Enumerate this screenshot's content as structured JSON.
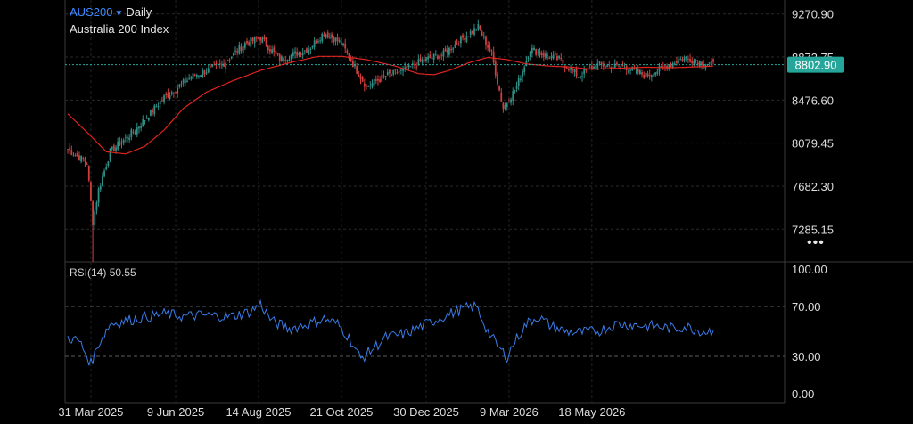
{
  "header": {
    "symbol": "AUS200",
    "interval": "Daily",
    "subtitle": "Australia 200 Index"
  },
  "price_axis": {
    "labels": [
      "9270.90",
      "8873.75",
      "8476.60",
      "8079.45",
      "7682.30",
      "7285.15"
    ],
    "last_price": "8802.90"
  },
  "rsi": {
    "label": "RSI(14)",
    "value": "50.55",
    "axis_labels": [
      "100.00",
      "70.00",
      "30.00",
      "0.00"
    ]
  },
  "time_axis": {
    "labels": [
      "31 Mar 2025",
      "9 Jun 2025",
      "14 Aug 2025",
      "21 Oct 2025",
      "30 Dec 2025",
      "9 Mar 2026",
      "18 May 2026"
    ]
  },
  "more_glyph": "•••",
  "colors": {
    "background": "#000000",
    "up": "#2f8f86",
    "down": "#d03e3e",
    "ma": "#e0241f",
    "rsi": "#3a7ce8",
    "last_price": "#26a69a",
    "symbol": "#3d8bff"
  },
  "chart_data": [
    {
      "type": "candlestick",
      "ylim": [
        7000,
        9400
      ],
      "y_ticks": [
        9270.9,
        8873.75,
        8476.6,
        8079.45,
        7682.3,
        7285.15
      ],
      "last_price": 8802.9,
      "x_ticks": [
        "31 Mar 2025",
        "9 Jun 2025",
        "14 Aug 2025",
        "21 Oct 2025",
        "30 Dec 2025",
        "9 Mar 2026",
        "18 May 2026"
      ],
      "close_keypoints": [
        [
          0,
          8020
        ],
        [
          10,
          7900
        ],
        [
          13,
          7350
        ],
        [
          16,
          7650
        ],
        [
          22,
          8000
        ],
        [
          35,
          8200
        ],
        [
          50,
          8500
        ],
        [
          65,
          8700
        ],
        [
          80,
          8800
        ],
        [
          92,
          9000
        ],
        [
          100,
          9050
        ],
        [
          110,
          8850
        ],
        [
          125,
          8950
        ],
        [
          133,
          9100
        ],
        [
          142,
          9000
        ],
        [
          150,
          8750
        ],
        [
          155,
          8600
        ],
        [
          165,
          8700
        ],
        [
          175,
          8750
        ],
        [
          185,
          8850
        ],
        [
          195,
          8900
        ],
        [
          205,
          9050
        ],
        [
          213,
          9150
        ],
        [
          220,
          8900
        ],
        [
          226,
          8400
        ],
        [
          233,
          8600
        ],
        [
          240,
          8950
        ],
        [
          246,
          8900
        ],
        [
          255,
          8850
        ],
        [
          265,
          8700
        ],
        [
          275,
          8800
        ],
        [
          290,
          8780
        ],
        [
          300,
          8700
        ],
        [
          312,
          8800
        ],
        [
          320,
          8870
        ],
        [
          330,
          8820
        ],
        [
          335,
          8803
        ]
      ],
      "ma_keypoints": [
        [
          0,
          8350
        ],
        [
          10,
          8180
        ],
        [
          20,
          8000
        ],
        [
          30,
          7980
        ],
        [
          40,
          8050
        ],
        [
          50,
          8200
        ],
        [
          60,
          8400
        ],
        [
          72,
          8550
        ],
        [
          85,
          8650
        ],
        [
          100,
          8750
        ],
        [
          115,
          8820
        ],
        [
          130,
          8880
        ],
        [
          142,
          8880
        ],
        [
          155,
          8850
        ],
        [
          170,
          8790
        ],
        [
          182,
          8720
        ],
        [
          190,
          8710
        ],
        [
          198,
          8750
        ],
        [
          208,
          8820
        ],
        [
          218,
          8870
        ],
        [
          228,
          8850
        ],
        [
          238,
          8810
        ],
        [
          250,
          8790
        ],
        [
          262,
          8780
        ],
        [
          272,
          8760
        ],
        [
          285,
          8770
        ],
        [
          300,
          8780
        ],
        [
          312,
          8775
        ],
        [
          322,
          8780
        ],
        [
          335,
          8790
        ]
      ]
    },
    {
      "type": "line",
      "series": [
        {
          "name": "RSI(14)"
        }
      ],
      "ylim": [
        0,
        100
      ],
      "y_ticks": [
        100,
        70,
        30,
        0
      ],
      "reference_lines": [
        70,
        30
      ],
      "last_value": 50.55,
      "keypoints": [
        [
          0,
          45
        ],
        [
          6,
          42
        ],
        [
          10,
          30
        ],
        [
          12,
          24
        ],
        [
          16,
          40
        ],
        [
          22,
          56
        ],
        [
          35,
          60
        ],
        [
          50,
          64
        ],
        [
          60,
          62
        ],
        [
          70,
          63
        ],
        [
          85,
          62
        ],
        [
          95,
          66
        ],
        [
          100,
          72
        ],
        [
          106,
          58
        ],
        [
          115,
          52
        ],
        [
          125,
          56
        ],
        [
          133,
          60
        ],
        [
          140,
          56
        ],
        [
          146,
          45
        ],
        [
          152,
          28
        ],
        [
          156,
          33
        ],
        [
          165,
          45
        ],
        [
          175,
          48
        ],
        [
          185,
          55
        ],
        [
          195,
          62
        ],
        [
          205,
          68
        ],
        [
          212,
          70
        ],
        [
          218,
          50
        ],
        [
          224,
          36
        ],
        [
          228,
          30
        ],
        [
          232,
          42
        ],
        [
          238,
          56
        ],
        [
          244,
          62
        ],
        [
          250,
          55
        ],
        [
          258,
          50
        ],
        [
          265,
          49
        ],
        [
          275,
          50
        ],
        [
          285,
          56
        ],
        [
          295,
          55
        ],
        [
          305,
          54
        ],
        [
          315,
          52
        ],
        [
          320,
          54
        ],
        [
          330,
          50
        ],
        [
          335,
          50.55
        ]
      ]
    }
  ]
}
